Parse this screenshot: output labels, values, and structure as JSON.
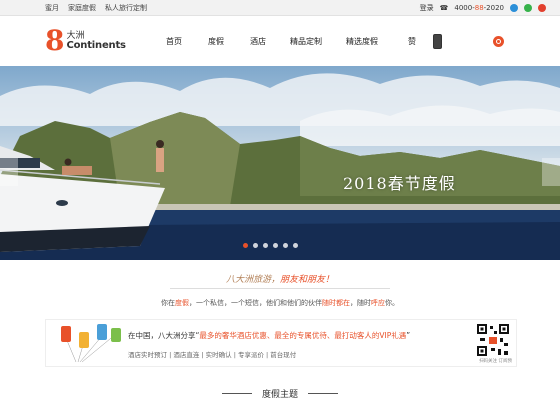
{
  "topbar": {
    "links": [
      "蜜月",
      "家庭度假",
      "私人旅行定制"
    ],
    "login": "登录",
    "phone_prefix": "4000-",
    "phone_mid": "88",
    "phone_suffix": "-2020"
  },
  "logo": {
    "number": "8",
    "cn": "大洲",
    "en": "Continents"
  },
  "nav": [
    "首页",
    "度假",
    "酒店",
    "精品定制",
    "精选度假",
    "赞"
  ],
  "hero": {
    "title": "2018春节度假",
    "slide_count": 6,
    "active_slide": 0
  },
  "slogan": {
    "part1": "八大洲旅游，",
    "part2": "朋友和",
    "part3": "朋友！"
  },
  "intro": {
    "p1": "你在",
    "h1": "度假",
    "p2": "，一个私信，一个短信，他们和他们的伙伴",
    "h2": "随时都在",
    "p3": "，随时",
    "h3": "呼应",
    "p4": "你。"
  },
  "promo": {
    "p1": "在中国，八大洲分享“",
    "h1": "最多的奢华酒店优惠、最全的专属优待、最打动客人的VIP礼遇",
    "p2": "”",
    "tags": "酒店实时预订  |  酒店直连  |  实时确认  |  专享派价  |  前台现付",
    "qr_caption": "扫码关注 订阅预"
  },
  "section_title": "度假主题",
  "colors": {
    "accent": "#e8512a"
  }
}
